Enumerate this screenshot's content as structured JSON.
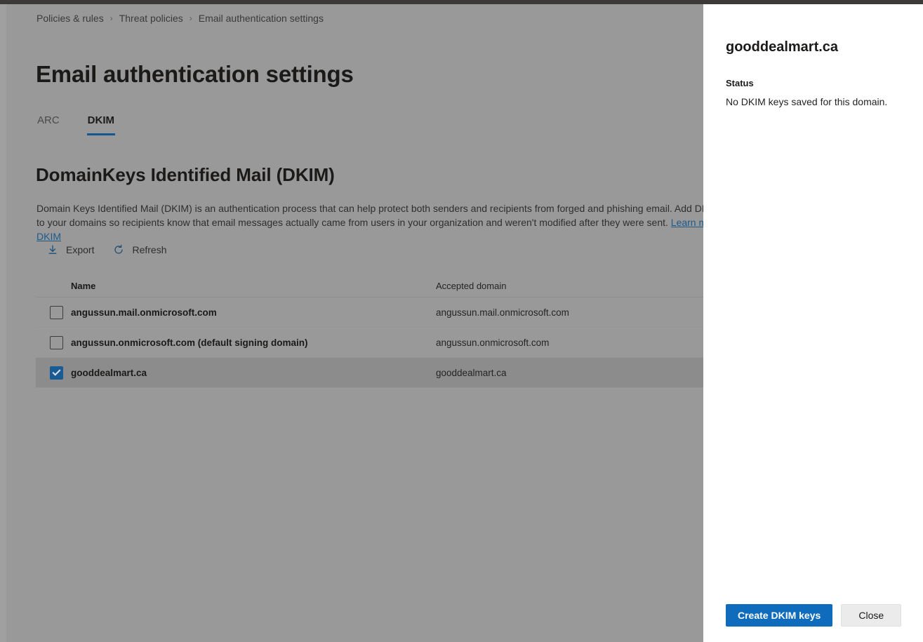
{
  "breadcrumb": {
    "items": [
      "Policies & rules",
      "Threat policies",
      "Email authentication settings"
    ],
    "separator": "›"
  },
  "page": {
    "title": "Email authentication settings"
  },
  "tabs": [
    {
      "label": "ARC",
      "selected": false
    },
    {
      "label": "DKIM",
      "selected": true
    }
  ],
  "section": {
    "title": "DomainKeys Identified Mail (DKIM)",
    "description": "Domain Keys Identified Mail (DKIM) is an authentication process that can help protect both senders and recipients from forged and phishing email. Add DKIM signatures to your domains so recipients know that email messages actually came from users in your organization and weren't modified after they were sent. ",
    "link_text": "Learn more about DKIM"
  },
  "commandbar": {
    "export_label": "Export",
    "export_icon": "download-icon",
    "refresh_label": "Refresh",
    "refresh_icon": "refresh-icon"
  },
  "table": {
    "columns": [
      "Name",
      "Accepted domain"
    ],
    "rows": [
      {
        "name": "angussun.mail.onmicrosoft.com",
        "accepted_domain": "angussun.mail.onmicrosoft.com",
        "checked": false,
        "selected": false
      },
      {
        "name": "angussun.onmicrosoft.com (default signing domain)",
        "accepted_domain": "angussun.onmicrosoft.com",
        "checked": false,
        "selected": false
      },
      {
        "name": "gooddealmart.ca",
        "accepted_domain": "gooddealmart.ca",
        "checked": true,
        "selected": true
      }
    ]
  },
  "panel": {
    "title": "gooddealmart.ca",
    "status_label": "Status",
    "status_value": "No DKIM keys saved for this domain.",
    "primary_button": "Create DKIM keys",
    "secondary_button": "Close"
  },
  "colors": {
    "accent": "#0f6cbd",
    "tab_underline": "#15578f",
    "link": "#1d5a8c",
    "overlay": "#999999",
    "selected_row": "#8c8c8c",
    "checkbox_checked": "#1b5b94"
  }
}
